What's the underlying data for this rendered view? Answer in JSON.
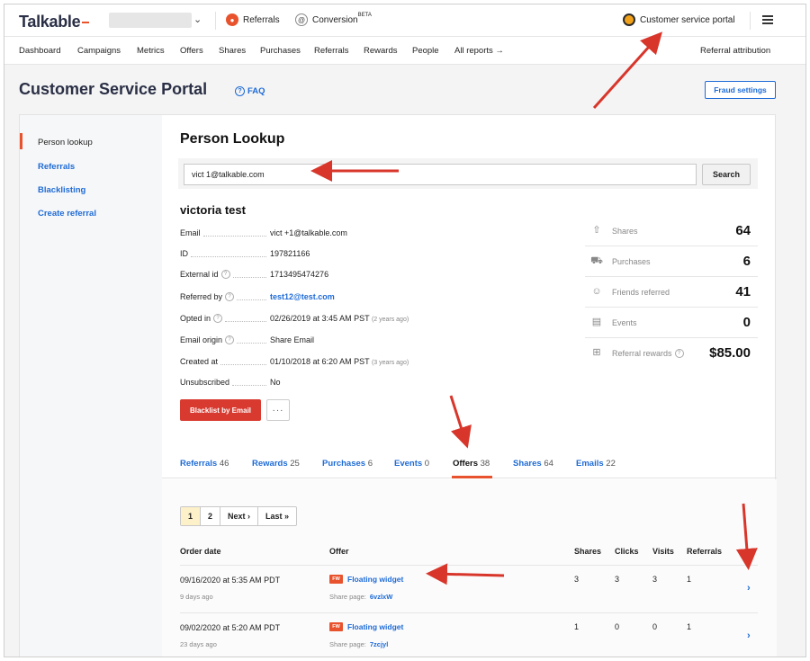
{
  "topbar": {
    "logo": "Talkable",
    "products": [
      {
        "label": "Referrals",
        "icon": "referrals-icon"
      },
      {
        "label": "Conversion",
        "sup": "BETA",
        "icon": "at-icon"
      }
    ],
    "csp_label": "Customer service portal"
  },
  "nav": {
    "items": [
      "Dashboard",
      "Campaigns",
      "Metrics",
      "Offers",
      "Shares",
      "Purchases",
      "Referrals",
      "Rewards",
      "People"
    ],
    "all_reports": "All reports →",
    "right": "Referral attribution"
  },
  "header": {
    "title": "Customer Service Portal",
    "faq": "FAQ",
    "fraud_button": "Fraud settings"
  },
  "sidebar": {
    "items": [
      {
        "label": "Person lookup"
      },
      {
        "label": "Referrals"
      },
      {
        "label": "Blacklisting"
      },
      {
        "label": "Create referral"
      }
    ]
  },
  "lookup": {
    "title": "Person Lookup",
    "search_value": "vict        1@talkable.com",
    "search_button": "Search"
  },
  "person": {
    "name": "victoria test",
    "props": [
      {
        "label": "Email",
        "value": "vict      +1@talkable.com"
      },
      {
        "label": "ID",
        "value": "197821166"
      },
      {
        "label": "External id",
        "value": "1713495474276"
      },
      {
        "label": "Referred by",
        "value": "test12@test.com"
      },
      {
        "label": "Opted in",
        "value": "02/26/2019 at 3:45 AM PST",
        "note": "(2 years ago)"
      },
      {
        "label": "Email origin",
        "value": "Share Email"
      },
      {
        "label": "Created at",
        "value": "01/10/2018 at 6:20 AM PST",
        "note": "(3 years ago)"
      },
      {
        "label": "Unsubscribed",
        "value": "No"
      }
    ],
    "blacklist_button": "Blacklist by Email",
    "more_button": "···"
  },
  "stats": [
    {
      "label": "Shares",
      "value": "64"
    },
    {
      "label": "Purchases",
      "value": "6"
    },
    {
      "label": "Friends referred",
      "value": "41"
    },
    {
      "label": "Events",
      "value": "0"
    },
    {
      "label": "Referral rewards",
      "value": "$85.00"
    }
  ],
  "tabs": [
    {
      "label": "Referrals",
      "count": "46"
    },
    {
      "label": "Rewards",
      "count": "25"
    },
    {
      "label": "Purchases",
      "count": "6"
    },
    {
      "label": "Events",
      "count": "0"
    },
    {
      "label": "Offers",
      "count": "38",
      "active": true
    },
    {
      "label": "Shares",
      "count": "64"
    },
    {
      "label": "Emails",
      "count": "22"
    }
  ],
  "pager": {
    "pages": [
      "1",
      "2"
    ],
    "next": "Next ›",
    "last": "Last »"
  },
  "table": {
    "headers": [
      "Order date",
      "Offer",
      "Shares",
      "Clicks",
      "Visits",
      "Referrals"
    ],
    "rows": [
      {
        "date": "09/16/2020 at 5:35 AM PDT",
        "ago": "9 days ago",
        "badge": "FW",
        "offer": "Floating widget",
        "share_label": "Share page:",
        "share_code": "6vzlxW",
        "shares": "3",
        "clicks": "3",
        "visits": "3",
        "referrals": "1"
      },
      {
        "date": "09/02/2020 at 5:20 AM PDT",
        "ago": "23 days ago",
        "badge": "FW",
        "offer": "Floating widget",
        "share_label": "Share page:",
        "share_code": "7zcjyl",
        "shares": "1",
        "clicks": "0",
        "visits": "0",
        "referrals": "1"
      }
    ]
  },
  "colors": {
    "accent": "#e8532d",
    "link": "#1e6bd6",
    "danger": "#d83a2f",
    "arrow": "#d8362b"
  }
}
